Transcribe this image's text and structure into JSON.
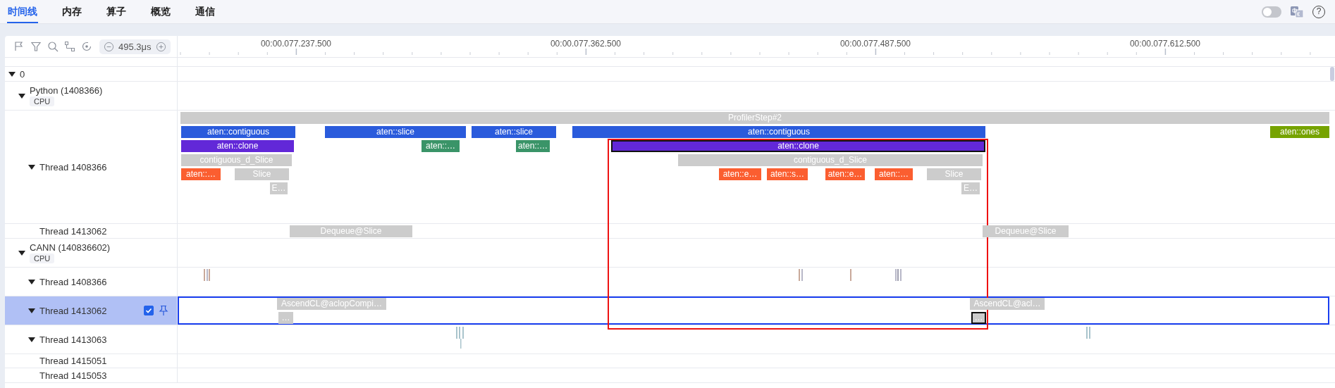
{
  "tabs": [
    {
      "label": "时间线",
      "selected": true
    },
    {
      "label": "内存",
      "selected": false
    },
    {
      "label": "算子",
      "selected": false
    },
    {
      "label": "概览",
      "selected": false
    },
    {
      "label": "通信",
      "selected": false
    }
  ],
  "header_controls": {
    "toggle_on": false,
    "help": "?"
  },
  "toolbar": {
    "zoom_value": "495.3μs"
  },
  "ruler": {
    "labels": [
      "00:00.077.237.500",
      "00:00.077.362.500",
      "00:00.077.487.500",
      "00:00.077.612.500"
    ]
  },
  "tree": {
    "label": "0",
    "expanded": true,
    "processes": [
      {
        "name": "Python (1408366)",
        "badge": "CPU",
        "expanded": true,
        "threads": [
          {
            "name": "Thread 1408366",
            "kind": "expandable",
            "expanded": true,
            "selected": false,
            "slices": [
              {
                "label": "ProfilerStep#2",
                "color": "#cccccc",
                "selected": false
              },
              {
                "label": "aten::contiguous",
                "color": "#2a5bdc",
                "selected": false
              },
              {
                "label": "aten::slice",
                "color": "#2a5bdc",
                "selected": false
              },
              {
                "label": "aten::slice",
                "color": "#2a5bdc",
                "selected": false
              },
              {
                "label": "aten::contiguous",
                "color": "#2a5bdc",
                "selected": false
              },
              {
                "label": "aten::ones",
                "color": "#76a300",
                "selected": false
              },
              {
                "label": "aten::clone",
                "color": "#6228d8",
                "selected": false
              },
              {
                "label": "aten::…",
                "color": "#3a9468",
                "selected": false
              },
              {
                "label": "aten::…",
                "color": "#3a9468",
                "selected": false
              },
              {
                "label": "aten::clone",
                "color": "#6228d8",
                "selected": true
              },
              {
                "label": "contiguous_d_Slice",
                "color": "#cccccc",
                "selected": false
              },
              {
                "label": "contiguous_d_Slice",
                "color": "#cccccc",
                "selected": false
              },
              {
                "label": "aten::…",
                "color": "#fb5e30",
                "selected": false
              },
              {
                "label": "Slice",
                "color": "#cccccc",
                "selected": false
              },
              {
                "label": "aten::e…",
                "color": "#fb5e30",
                "selected": false
              },
              {
                "label": "aten::s…",
                "color": "#fb5e30",
                "selected": false
              },
              {
                "label": "aten::e…",
                "color": "#fb5e30",
                "selected": false
              },
              {
                "label": "aten::…",
                "color": "#fb5e30",
                "selected": false
              },
              {
                "label": "Slice",
                "color": "#cccccc",
                "selected": false
              },
              {
                "label": "E…",
                "color": "#cccccc",
                "selected": false
              },
              {
                "label": "E…",
                "color": "#cccccc",
                "selected": false
              }
            ]
          },
          {
            "name": "Thread 1413062",
            "kind": "leaf",
            "selected": false,
            "slices": [
              {
                "label": "Dequeue@Slice",
                "color": "#cccccc",
                "selected": false
              },
              {
                "label": "Dequeue@Slice",
                "color": "#cccccc",
                "selected": false
              }
            ]
          }
        ]
      },
      {
        "name": "CANN (140836602)",
        "badge": "CPU",
        "expanded": true,
        "threads": [
          {
            "name": "Thread 1408366",
            "kind": "expandable",
            "expanded": true,
            "selected": false
          },
          {
            "name": "Thread 1413062",
            "kind": "expandable",
            "expanded": true,
            "selected": true,
            "checked": true,
            "slices": [
              {
                "label": "AscendCL@aclopCompi…",
                "color": "#cccccc",
                "selected": false
              },
              {
                "label": "…",
                "color": "#cccccc",
                "selected": false
              },
              {
                "label": "AscendCL@acl…",
                "color": "#cccccc",
                "selected": false
              },
              {
                "label": "…",
                "color": "#cccccc",
                "selected": true
              }
            ]
          },
          {
            "name": "Thread 1413063",
            "kind": "expandable",
            "expanded": true,
            "selected": false
          },
          {
            "name": "Thread 1415051",
            "kind": "leaf",
            "selected": false
          },
          {
            "name": "Thread 1415053",
            "kind": "leaf",
            "selected": false
          }
        ]
      }
    ]
  }
}
